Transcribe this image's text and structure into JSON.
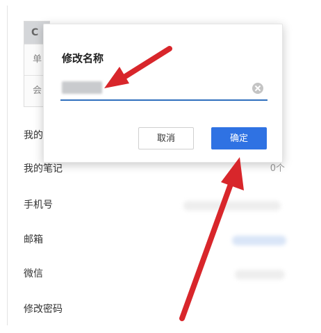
{
  "card": {
    "head_initial": "C",
    "row1_label": "单",
    "row2_label": "会"
  },
  "settings": {
    "items": [
      {
        "label": "我的",
        "value": ""
      },
      {
        "label": "我的笔记",
        "value": "0个"
      },
      {
        "label": "手机号",
        "value": ""
      },
      {
        "label": "邮箱",
        "value": ""
      },
      {
        "label": "微信",
        "value": ""
      },
      {
        "label": "修改密码",
        "value": ""
      }
    ]
  },
  "dialog": {
    "title": "修改名称",
    "cancel_label": "取消",
    "ok_label": "确定"
  },
  "colors": {
    "accent": "#2f72e3",
    "field_underline": "#2f6fbd",
    "annotation_arrow": "#d8262b"
  }
}
